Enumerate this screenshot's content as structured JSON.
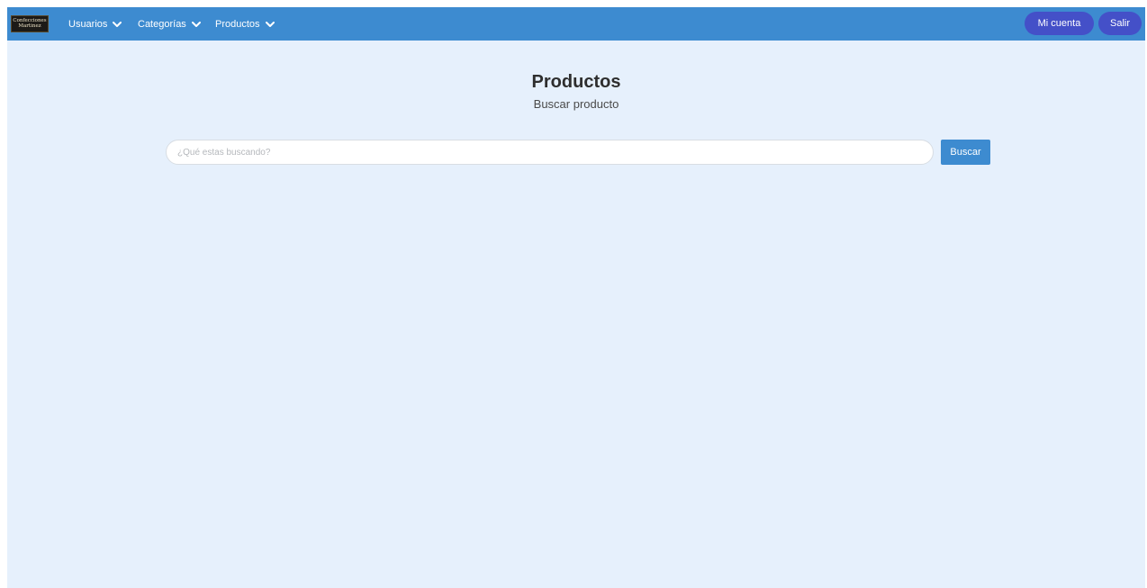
{
  "brand": {
    "logo_line1": "Confecciones",
    "logo_line2": "Martinez"
  },
  "nav": {
    "items": [
      {
        "label": "Usuarios",
        "icon": "chevron-down-icon"
      },
      {
        "label": "Categorías",
        "icon": "chevron-down-icon"
      },
      {
        "label": "Productos",
        "icon": "chevron-down-icon"
      }
    ],
    "account_label": "Mi cuenta",
    "logout_label": "Salir"
  },
  "page": {
    "title": "Productos",
    "subtitle": "Buscar producto"
  },
  "search": {
    "placeholder": "¿Qué estas buscando?",
    "value": "",
    "button_label": "Buscar"
  },
  "colors": {
    "navbar": "#3d8bd0",
    "background": "#e6f0fc",
    "pill_buttons": "#4450c8",
    "search_button": "#3d8bd0"
  }
}
